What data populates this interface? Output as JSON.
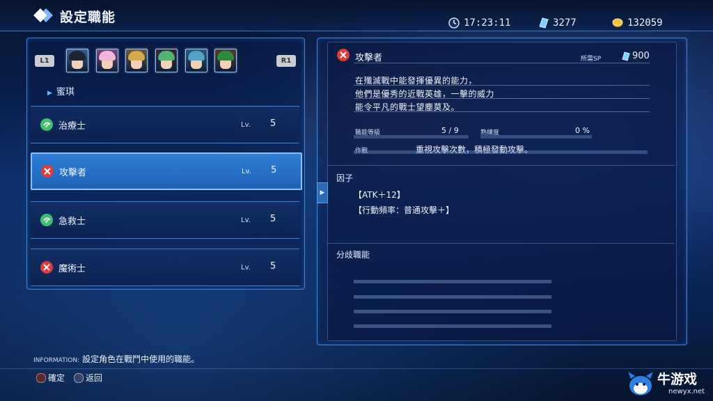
{
  "header": {
    "title": "設定職能",
    "time": "17:23:11",
    "crystals": "3277",
    "gold": "132059"
  },
  "party": {
    "l_button": "L1",
    "r_button": "R1",
    "selected_character": "蜜琪",
    "portraits": [
      {
        "hair": "#1b2430",
        "bg": "#3a5f8a"
      },
      {
        "hair": "#f4b6d8",
        "bg": "#7a4a7a"
      },
      {
        "hair": "#d7a94d",
        "bg": "#6a5a3a"
      },
      {
        "hair": "#53b372",
        "bg": "#3a2a3a"
      },
      {
        "hair": "#4fa3c9",
        "bg": "#2e5a70"
      },
      {
        "hair": "#2f8a3d",
        "bg": "#5a3a2a"
      }
    ]
  },
  "jobs": [
    {
      "name": "治療士",
      "lv_label": "Lv.",
      "lv": "5",
      "icon": "heal-icon",
      "color": "#3fbf6f"
    },
    {
      "name": "攻擊者",
      "lv_label": "Lv.",
      "lv": "5",
      "icon": "attack-icon",
      "color": "#e23a3a"
    },
    {
      "name": "急救士",
      "lv_label": "Lv.",
      "lv": "5",
      "icon": "heal-icon",
      "color": "#3fbf6f"
    },
    {
      "name": "魔術士",
      "lv_label": "Lv.",
      "lv": "5",
      "icon": "attack-icon",
      "color": "#e23a3a"
    }
  ],
  "detail": {
    "title": "攻擊者",
    "sp_label": "所需SP",
    "sp_value": "900",
    "description": [
      "在殲滅戰中能發揮優異的能力，",
      "他們是優秀的近戰英雄，一擊的威力",
      "能令平凡的戰士望塵莫及。"
    ],
    "job_level_label": "職能等級",
    "job_level_value": "5 / 9",
    "proficiency_label": "熟練度",
    "proficiency_value": "0 %",
    "tactic_label": "作戰",
    "tactic_value": "重視攻擊次數，積極發動攻擊。",
    "factor_title": "因子",
    "factors": [
      "【ATK＋12】",
      "【行動頻率：普通攻擊＋】"
    ],
    "branch_title": "分歧職能"
  },
  "info": {
    "label": "INFORMATION:",
    "text": "設定角色在戰鬥中使用的職能。"
  },
  "controls": {
    "confirm": "確定",
    "back": "返回"
  },
  "watermark": {
    "text": "牛游戏",
    "url": "newyx.net"
  }
}
